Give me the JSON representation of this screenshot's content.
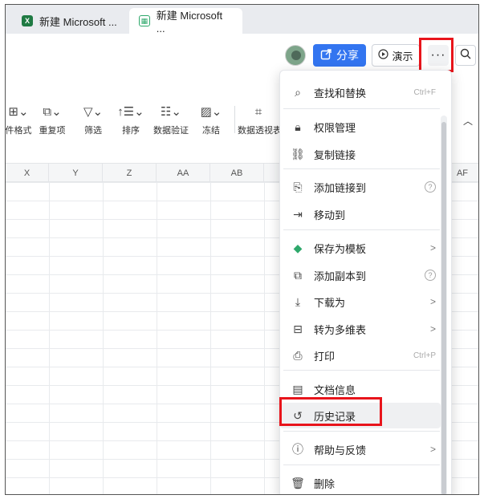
{
  "tabs": [
    {
      "label": "新建 Microsoft ...",
      "icon": "excel-icon"
    },
    {
      "label": "新建 Microsoft ...",
      "icon": "sheet-icon"
    }
  ],
  "header": {
    "share_label": "分享",
    "present_label": "演示",
    "more_label": "···"
  },
  "toolbar": {
    "items": [
      {
        "label": "件格式",
        "icon": "conditional-format-icon"
      },
      {
        "label": "重复项",
        "icon": "duplicate-icon"
      },
      {
        "label": "筛选",
        "icon": "filter-icon"
      },
      {
        "label": "排序",
        "icon": "sort-icon"
      },
      {
        "label": "数据验证",
        "icon": "data-validation-icon"
      },
      {
        "label": "冻结",
        "icon": "freeze-icon"
      },
      {
        "label": "数据透视表",
        "icon": "pivot-table-icon"
      }
    ]
  },
  "grid": {
    "columns": [
      "X",
      "Y",
      "Z",
      "AA",
      "AB",
      "AF"
    ]
  },
  "menu": {
    "items": [
      {
        "label": "查找和替换",
        "icon": "find-replace-icon",
        "shortcut": "Ctrl+F"
      },
      {
        "label": "权限管理",
        "icon": "lock-icon"
      },
      {
        "label": "复制链接",
        "icon": "link-icon"
      },
      {
        "label": "添加链接到",
        "icon": "add-link-icon",
        "help": "?"
      },
      {
        "label": "移动到",
        "icon": "move-icon"
      },
      {
        "label": "保存为模板",
        "icon": "template-icon",
        "arrow": ">"
      },
      {
        "label": "添加副本到",
        "icon": "copy-icon",
        "help": "?"
      },
      {
        "label": "下载为",
        "icon": "download-icon",
        "arrow": ">"
      },
      {
        "label": "转为多维表",
        "icon": "convert-icon",
        "arrow": ">"
      },
      {
        "label": "打印",
        "icon": "print-icon",
        "shortcut": "Ctrl+P"
      },
      {
        "label": "文档信息",
        "icon": "doc-info-icon"
      },
      {
        "label": "历史记录",
        "icon": "history-icon"
      },
      {
        "label": "帮助与反馈",
        "icon": "help-icon",
        "arrow": ">"
      },
      {
        "label": "删除",
        "icon": "trash-icon"
      }
    ]
  },
  "colors": {
    "accent": "#3375f0",
    "highlight": "#e8141b"
  }
}
